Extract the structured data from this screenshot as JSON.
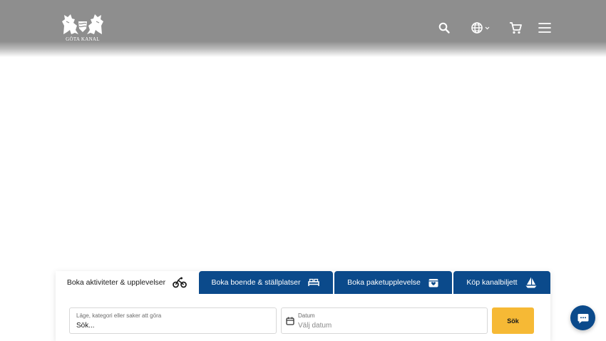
{
  "header": {
    "logo_text": "GÖTA KANAL",
    "icons": [
      "search-icon",
      "globe-icon",
      "chevron-down-icon",
      "cart-icon",
      "menu-icon"
    ]
  },
  "booking": {
    "tabs": [
      {
        "label": "Boka aktiviteter & upplevelser",
        "icon": "bicycle-icon",
        "active": true
      },
      {
        "label": "Boka boende & ställplatser",
        "icon": "bed-icon",
        "active": false
      },
      {
        "label": "Boka paketupplevelse",
        "icon": "gift-box-icon",
        "active": false
      },
      {
        "label": "Köp kanalbiljett",
        "icon": "sailboat-icon",
        "active": false
      }
    ],
    "location_field": {
      "label": "Läge, kategori eller saker att göra",
      "value": "Sök..."
    },
    "date_field": {
      "label": "Datum",
      "placeholder": "Välj datum"
    },
    "search_label": "Sök"
  },
  "colors": {
    "header_bg": "#8e8e8e",
    "tab_blue": "#0b4a8b",
    "search_button": "#f6b935",
    "chat_button": "#0b4a8b"
  }
}
